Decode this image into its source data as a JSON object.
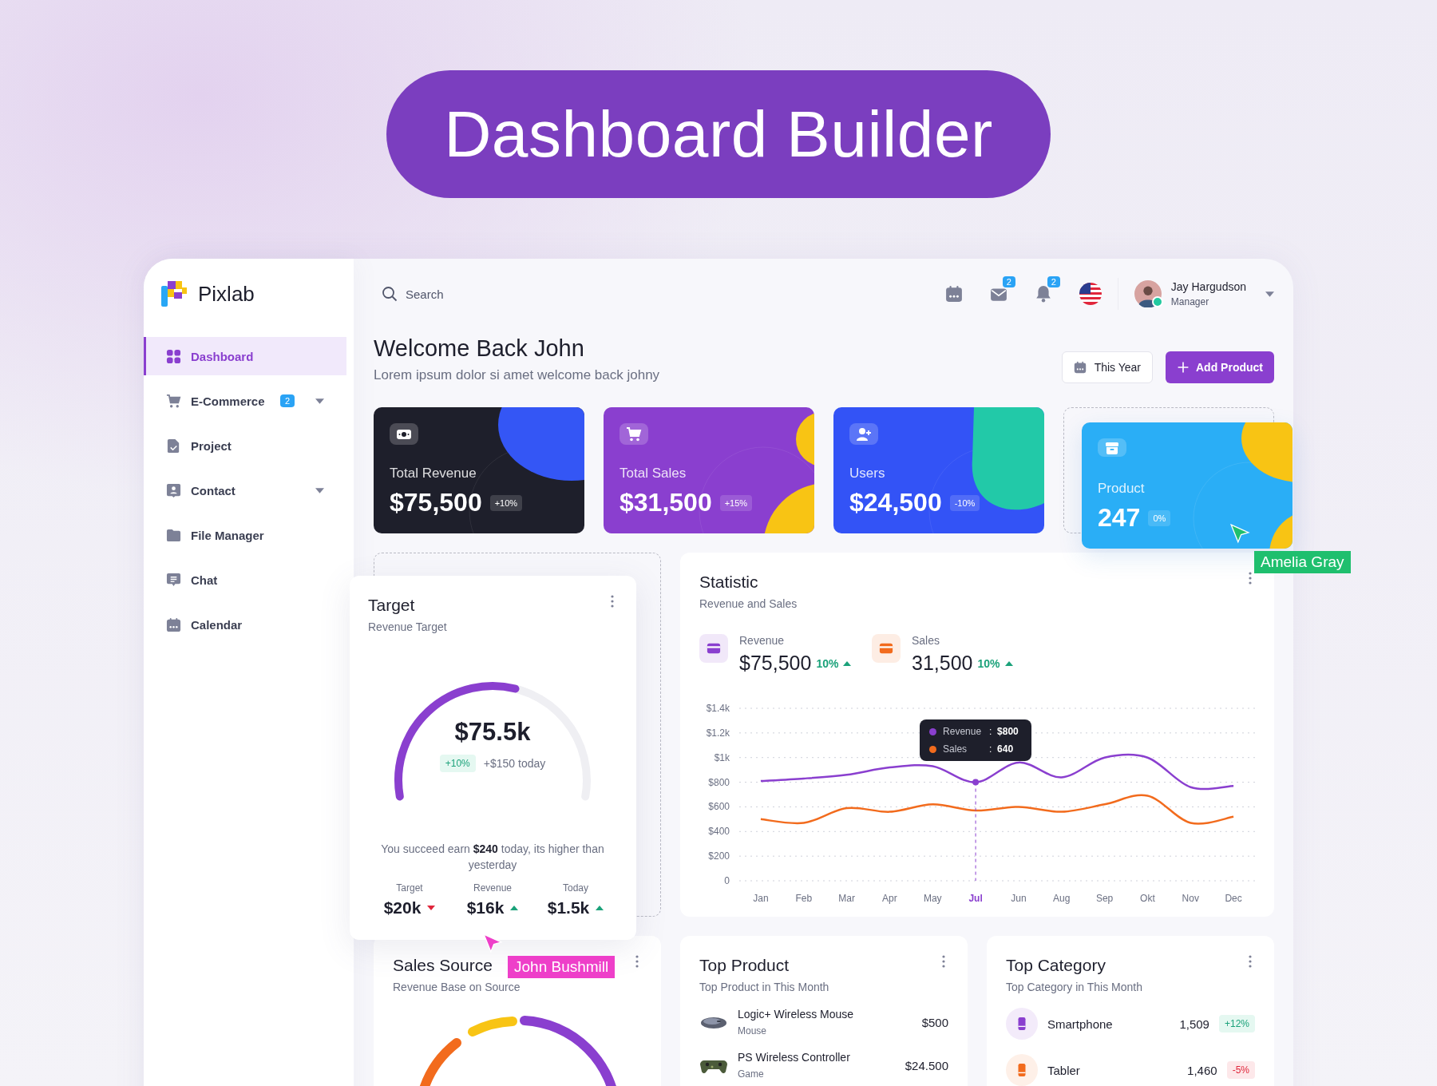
{
  "banner": {
    "title": "Dashboard Builder"
  },
  "brand": {
    "name": "Pixlab"
  },
  "sidebar": {
    "items": [
      {
        "label": "Dashboard",
        "selected": true,
        "expandable": false
      },
      {
        "label": "E-Commerce",
        "selected": false,
        "expandable": true,
        "badge": "2"
      },
      {
        "label": "Project",
        "selected": false,
        "expandable": false
      },
      {
        "label": "Contact",
        "selected": false,
        "expandable": true
      },
      {
        "label": "File Manager",
        "selected": false,
        "expandable": false
      },
      {
        "label": "Chat",
        "selected": false,
        "expandable": false
      },
      {
        "label": "Calendar",
        "selected": false,
        "expandable": false
      }
    ]
  },
  "header": {
    "search": {
      "placeholder": "Search"
    },
    "mail_badge": "2",
    "notification_badge": "2",
    "user": {
      "name": "Jay Hargudson",
      "role": "Manager",
      "online": true
    }
  },
  "welcome": {
    "title": "Welcome Back John",
    "subtitle": "Lorem ipsum dolor si amet welcome back johny"
  },
  "actions": {
    "period": "This Year",
    "add": "Add Product"
  },
  "stat_cards": [
    {
      "label": "Total Revenue",
      "value": "$75,500",
      "change": "+10%",
      "color": "#1e1f2b",
      "dragging": false
    },
    {
      "label": "Total Sales",
      "value": "$31,500",
      "change": "+15%",
      "color": "#8a3fcf",
      "dragging": false
    },
    {
      "label": "Users",
      "value": "$24,500",
      "change": "-10%",
      "color": "#3353f6",
      "dragging": false
    },
    {
      "label": "Product",
      "value": "247",
      "change": "0%",
      "color": "#2aaef6",
      "dragging": true
    }
  ],
  "target": {
    "title": "Target",
    "subtitle": "Revenue Target",
    "dragging": true,
    "value": "$75.5k",
    "badge": "+10%",
    "today": "+$150 today",
    "message": "You succeed earn **$240** today, its higher than yesterday",
    "stats": [
      {
        "label": "Target",
        "value": "$20k",
        "rising": false
      },
      {
        "label": "Revenue",
        "value": "$16k",
        "rising": true
      },
      {
        "label": "Today",
        "value": "$1.5k",
        "rising": true
      }
    ]
  },
  "statistic": {
    "title": "Statistic",
    "subtitle": "Revenue and Sales",
    "summary": [
      {
        "value": "$75,500",
        "change": "10%",
        "rising": true
      },
      {
        "value": "31,500",
        "change": "10%",
        "rising": true
      }
    ],
    "tooltip": [
      {
        "label": "Revenue",
        "separator": ":",
        "value": "$800"
      },
      {
        "label": "Sales",
        "separator": ":",
        "value": "640"
      }
    ],
    "chart_data": {
      "type": "line",
      "categories": [
        "Jan",
        "Feb",
        "Mar",
        "Apr",
        "May",
        "Jul",
        "Jun",
        "Aug",
        "Sep",
        "Okt",
        "Nov",
        "Dec"
      ],
      "ylim": [
        0,
        1400
      ],
      "grid": true,
      "legend": "top",
      "yticks": [
        {
          "value": 0,
          "label": "0"
        },
        {
          "value": 200,
          "label": "$200"
        },
        {
          "value": 400,
          "label": "$400"
        },
        {
          "value": 600,
          "label": "$600"
        },
        {
          "value": 800,
          "label": "$800"
        },
        {
          "value": 1000,
          "label": "$1k"
        },
        {
          "value": 1200,
          "label": "$1.2k"
        },
        {
          "value": 1400,
          "label": "$1.4k"
        }
      ],
      "series": [
        {
          "name": "Revenue",
          "color": "#8a3fcf",
          "values": [
            810,
            830,
            860,
            920,
            930,
            800,
            960,
            840,
            1000,
            1000,
            760,
            770
          ]
        },
        {
          "name": "Sales",
          "color": "#f26b1d",
          "values": [
            500,
            470,
            590,
            560,
            620,
            570,
            600,
            560,
            620,
            690,
            470,
            520
          ]
        }
      ],
      "annotations": [
        {
          "x": "Jul"
        }
      ]
    }
  },
  "sales_source": {
    "title": "Sales Source",
    "subtitle": "Revenue Base on Source"
  },
  "top_product": {
    "title": "Top Product",
    "subtitle": "Top Product in This Month",
    "rows": [
      {
        "name": "Logic+ Wireless Mouse",
        "category": "Mouse",
        "price": "$500"
      },
      {
        "name": "PS Wireless Controller",
        "category": "Game",
        "price": "$24.500"
      }
    ]
  },
  "top_category": {
    "title": "Top Category",
    "subtitle": "Top Category in This Month",
    "rows": [
      {
        "name": "Smartphone",
        "count": "1,509",
        "change": "+12%",
        "rising": true,
        "color": "#8a3fcf"
      },
      {
        "name": "Tabler",
        "count": "1,460",
        "change": "-5%",
        "rising": false,
        "color": "#f26b1d"
      }
    ]
  },
  "cursors": [
    {
      "name": "Amelia Gray",
      "color": "#1fbf6e"
    },
    {
      "name": "John Bushmill",
      "color": "#ee3fc9"
    }
  ]
}
